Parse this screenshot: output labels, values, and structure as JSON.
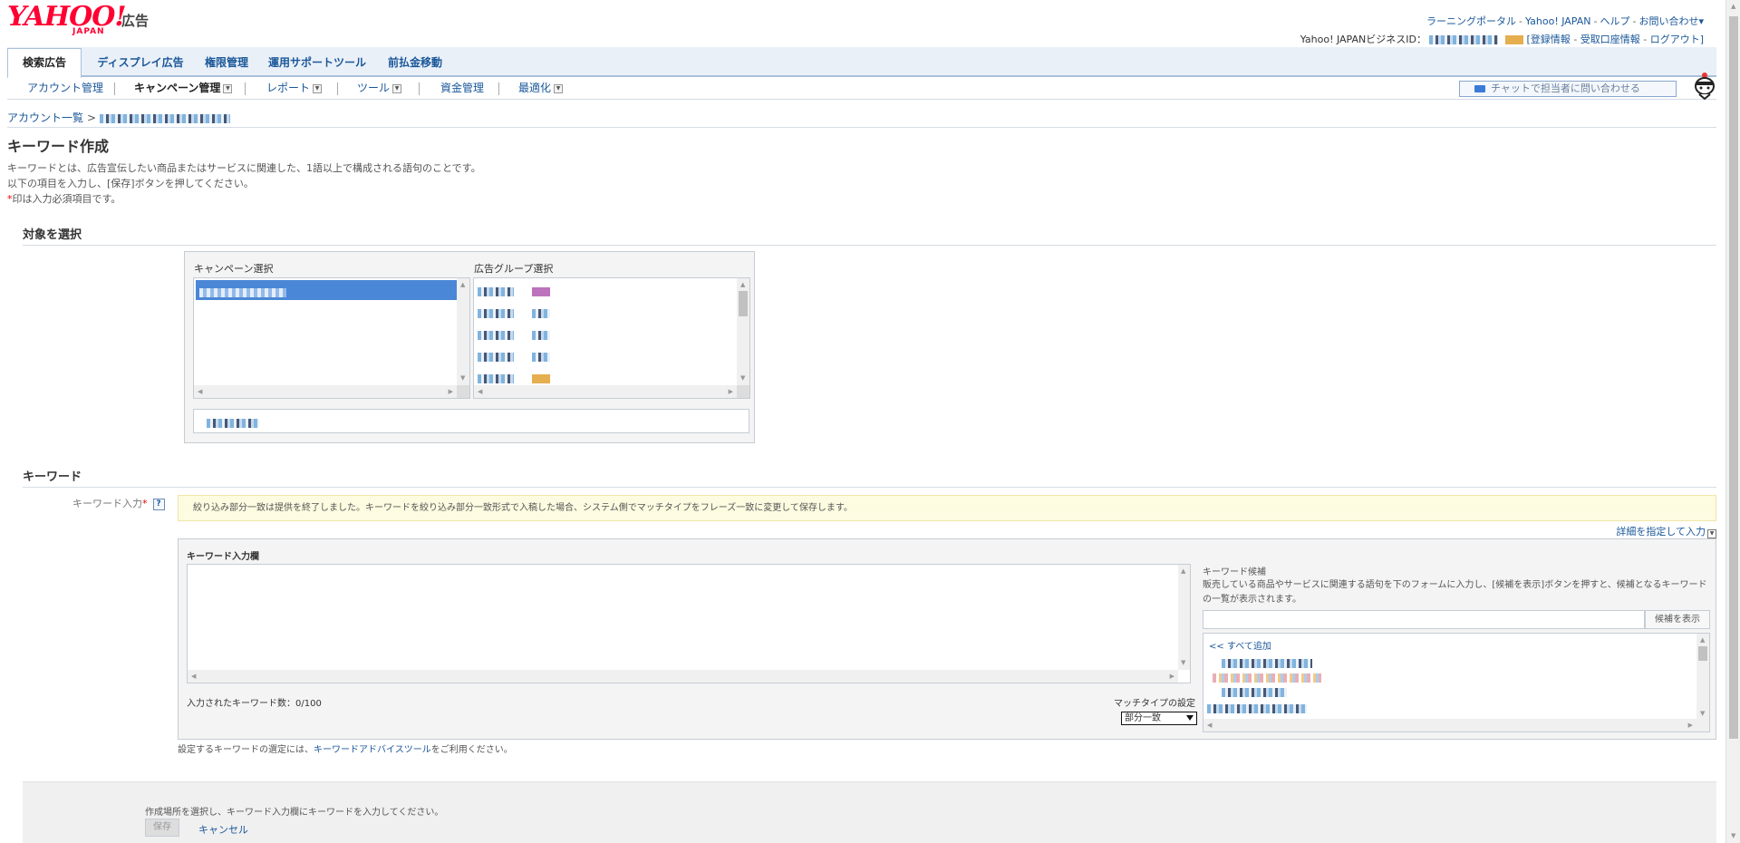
{
  "header": {
    "logo_yahoo": "YAHOO!",
    "logo_japan": "JAPAN",
    "logo_ad": "広告",
    "top_links": [
      "ラーニングポータル",
      "Yahoo! JAPAN",
      "ヘルプ",
      "お問い合わせ"
    ],
    "top_links_dropdown": "▾",
    "biz_id_label": "Yahoo! JAPANビジネスID：",
    "biz_links": [
      "[登録情報",
      "受取口座情報",
      "ログアウト]"
    ]
  },
  "main_tabs": [
    {
      "label": "検索広告",
      "active": true
    },
    {
      "label": "ディスプレイ広告",
      "active": false
    },
    {
      "label": "権限管理",
      "active": false
    },
    {
      "label": "運用サポートツール",
      "active": false
    },
    {
      "label": "前払金移動",
      "active": false
    }
  ],
  "sub_nav": [
    {
      "label": "アカウント管理"
    },
    {
      "label": "キャンペーン管理",
      "current": true
    },
    {
      "label": "レポート"
    },
    {
      "label": "ツール"
    },
    {
      "label": "資金管理"
    },
    {
      "label": "最適化"
    }
  ],
  "chat_button": "チャットで担当者に問い合わせる",
  "breadcrumb": {
    "root": "アカウント一覧",
    "separator": ">"
  },
  "page": {
    "title": "キーワード作成",
    "desc_lines": [
      "キーワードとは、広告宣伝したい商品またはサービスに関連した、1語以上で構成される語句のことです。",
      "以下の項目を入力し、[保存]ボタンを押してください。"
    ],
    "required_mark": "*",
    "required_note": "印は入力必須項目です。"
  },
  "target_section": {
    "heading": "対象を選択",
    "campaign_label": "キャンペーン選択",
    "adgroup_label": "広告グループ選択"
  },
  "keyword_section": {
    "heading": "キーワード",
    "input_label": "キーワード入力",
    "required_mark": "*",
    "help_icon": "?",
    "notice": "絞り込み部分一致は提供を終了しました。キーワードを絞り込み部分一致形式で入稿した場合、システム側でマッチタイプをフレーズ一致に変更して保存します。",
    "detail_link": "詳細を指定して入力",
    "panel_title": "キーワード入力欄",
    "count_text": "入力されたキーワード数：0/100",
    "match_type_label": "マッチタイプの設定",
    "match_type_value": "部分一致",
    "candidates_title": "キーワード候補",
    "candidates_desc": "販売している商品やサービスに関連する語句を下のフォームに入力し、[候補を表示]ボタンを押すと、候補となるキーワードの一覧が表示されます。",
    "show_candidates_button": "候補を表示",
    "add_all": "<< すべて追加",
    "advice_prefix": "設定するキーワードの選定には、",
    "advice_link": "キーワードアドバイスツール",
    "advice_suffix": "をご利用ください。"
  },
  "footer": {
    "message": "作成場所を選択し、キーワード入力欄にキーワードを入力してください。",
    "save_button": "保存",
    "cancel_link": "キャンセル"
  }
}
